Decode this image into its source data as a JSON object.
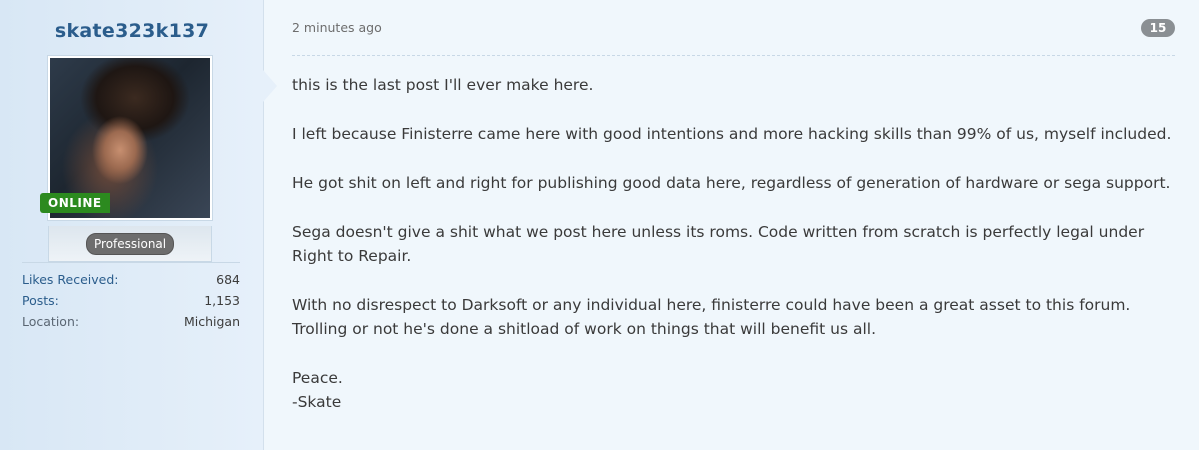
{
  "user": {
    "username": "skate323k137",
    "online_label": "ONLINE",
    "role": "Professional",
    "stats": [
      {
        "label": "Likes Received:",
        "value": "684",
        "link": true
      },
      {
        "label": "Posts:",
        "value": "1,153",
        "link": true
      },
      {
        "label": "Location:",
        "value": "Michigan",
        "link": false
      }
    ]
  },
  "post": {
    "timestamp": "2 minutes ago",
    "number": "15",
    "paragraphs": [
      "this is the last post I'll ever make here.",
      "I left because Finisterre came here with good intentions and more hacking skills than 99% of us, myself included.",
      "He got shit on left and right for publishing good data here, regardless of generation of hardware or sega support.",
      "Sega doesn't give a shit what we post here unless its roms. Code written from scratch is perfectly legal under Right to Repair.",
      "With no disrespect to Darksoft or any individual here, finisterre could have been a great asset to this forum. Trolling or not he's done a shitload of work on things that will benefit us all."
    ],
    "signoff": [
      "Peace.",
      "-Skate"
    ]
  }
}
